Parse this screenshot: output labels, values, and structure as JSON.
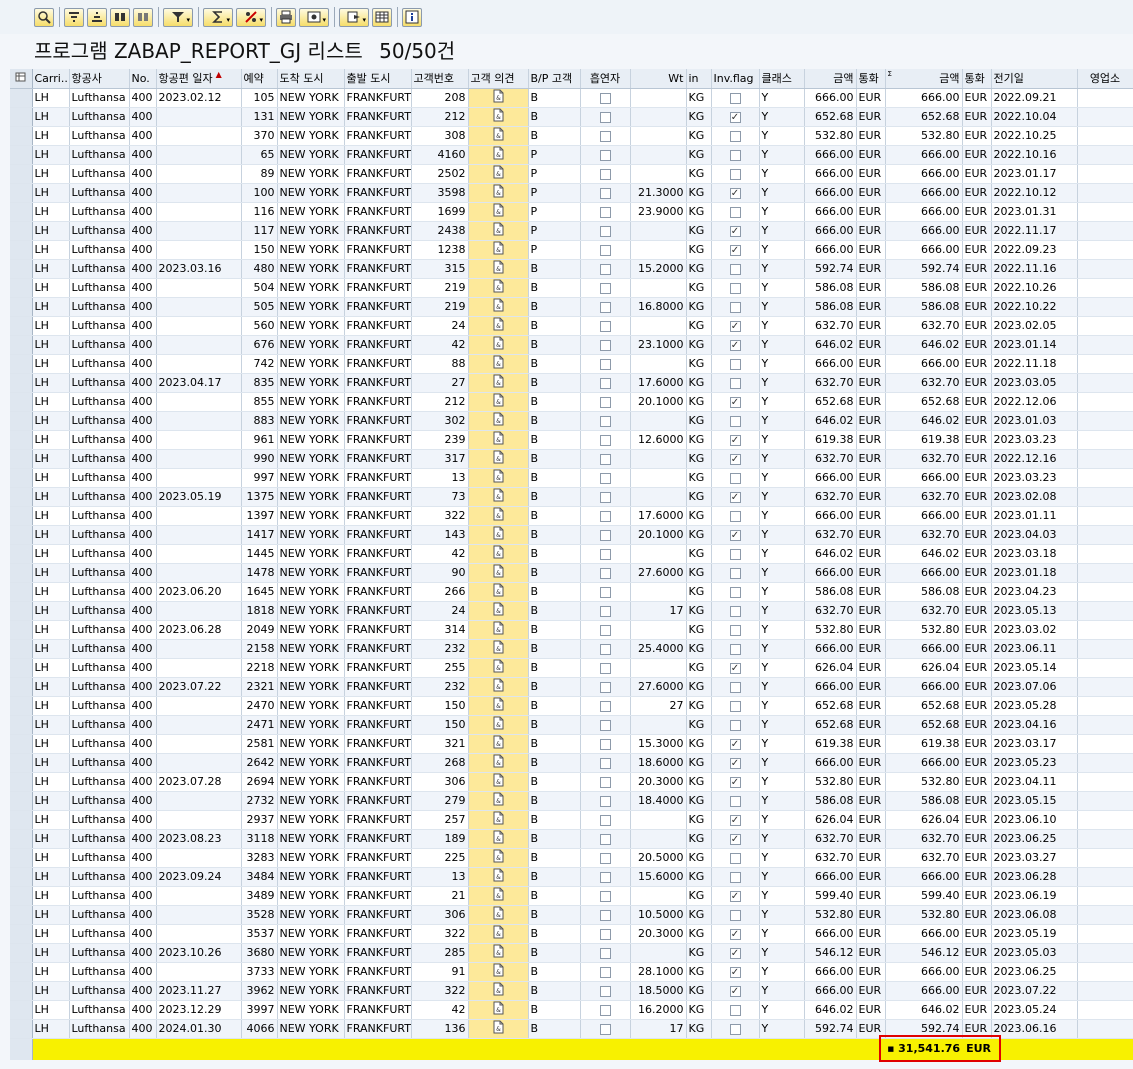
{
  "toolbar": {
    "buttons": [
      {
        "name": "details-icon"
      },
      {
        "name": "sort-ascending-icon"
      },
      {
        "name": "sort-descending-icon"
      },
      {
        "name": "find-icon"
      },
      {
        "name": "find-next-icon"
      },
      {
        "name": "filter-icon",
        "dropdown": true
      },
      {
        "name": "sum-icon",
        "dropdown": true
      },
      {
        "name": "subtotal-icon",
        "dropdown": true
      },
      {
        "name": "print-icon"
      },
      {
        "name": "view-icon",
        "dropdown": true
      },
      {
        "name": "export-icon",
        "dropdown": true
      },
      {
        "name": "layout-icon"
      },
      {
        "name": "info-icon"
      }
    ]
  },
  "title": {
    "program": "프로그램 ZABAP_REPORT_GJ 리스트",
    "count": "50/50건"
  },
  "columns": [
    "Carri...",
    "항공사",
    "No.",
    "항공편 일자",
    "예약",
    "도착 도시",
    "출발 도시",
    "고객번호",
    "고객 의견",
    "B/P 고객",
    "흡연자",
    "Wt",
    "in",
    "Inv.flag",
    "클래스",
    "금액",
    "통화",
    "금액",
    "통화",
    "전기일",
    "영업소"
  ],
  "rows": [
    [
      "LH",
      "Lufthansa",
      "400",
      "2023.02.12",
      "105",
      "NEW YORK",
      "FRANKFURT",
      "208",
      "B",
      false,
      "",
      "KG",
      false,
      "Y",
      "666.00",
      "EUR",
      "666.00",
      "EUR",
      "2022.09.21"
    ],
    [
      "LH",
      "Lufthansa",
      "400",
      "",
      "131",
      "NEW YORK",
      "FRANKFURT",
      "212",
      "B",
      false,
      "",
      "KG",
      true,
      "Y",
      "652.68",
      "EUR",
      "652.68",
      "EUR",
      "2022.10.04"
    ],
    [
      "LH",
      "Lufthansa",
      "400",
      "",
      "370",
      "NEW YORK",
      "FRANKFURT",
      "308",
      "B",
      false,
      "",
      "KG",
      false,
      "Y",
      "532.80",
      "EUR",
      "532.80",
      "EUR",
      "2022.10.25"
    ],
    [
      "LH",
      "Lufthansa",
      "400",
      "",
      "65",
      "NEW YORK",
      "FRANKFURT",
      "4160",
      "P",
      false,
      "",
      "KG",
      false,
      "Y",
      "666.00",
      "EUR",
      "666.00",
      "EUR",
      "2022.10.16"
    ],
    [
      "LH",
      "Lufthansa",
      "400",
      "",
      "89",
      "NEW YORK",
      "FRANKFURT",
      "2502",
      "P",
      false,
      "",
      "KG",
      false,
      "Y",
      "666.00",
      "EUR",
      "666.00",
      "EUR",
      "2023.01.17"
    ],
    [
      "LH",
      "Lufthansa",
      "400",
      "",
      "100",
      "NEW YORK",
      "FRANKFURT",
      "3598",
      "P",
      false,
      "21.3000",
      "KG",
      true,
      "Y",
      "666.00",
      "EUR",
      "666.00",
      "EUR",
      "2022.10.12"
    ],
    [
      "LH",
      "Lufthansa",
      "400",
      "",
      "116",
      "NEW YORK",
      "FRANKFURT",
      "1699",
      "P",
      false,
      "23.9000",
      "KG",
      false,
      "Y",
      "666.00",
      "EUR",
      "666.00",
      "EUR",
      "2023.01.31"
    ],
    [
      "LH",
      "Lufthansa",
      "400",
      "",
      "117",
      "NEW YORK",
      "FRANKFURT",
      "2438",
      "P",
      false,
      "",
      "KG",
      true,
      "Y",
      "666.00",
      "EUR",
      "666.00",
      "EUR",
      "2022.11.17"
    ],
    [
      "LH",
      "Lufthansa",
      "400",
      "",
      "150",
      "NEW YORK",
      "FRANKFURT",
      "1238",
      "P",
      false,
      "",
      "KG",
      true,
      "Y",
      "666.00",
      "EUR",
      "666.00",
      "EUR",
      "2022.09.23"
    ],
    [
      "LH",
      "Lufthansa",
      "400",
      "2023.03.16",
      "480",
      "NEW YORK",
      "FRANKFURT",
      "315",
      "B",
      false,
      "15.2000",
      "KG",
      false,
      "Y",
      "592.74",
      "EUR",
      "592.74",
      "EUR",
      "2022.11.16"
    ],
    [
      "LH",
      "Lufthansa",
      "400",
      "",
      "504",
      "NEW YORK",
      "FRANKFURT",
      "219",
      "B",
      false,
      "",
      "KG",
      false,
      "Y",
      "586.08",
      "EUR",
      "586.08",
      "EUR",
      "2022.10.26"
    ],
    [
      "LH",
      "Lufthansa",
      "400",
      "",
      "505",
      "NEW YORK",
      "FRANKFURT",
      "219",
      "B",
      false,
      "16.8000",
      "KG",
      false,
      "Y",
      "586.08",
      "EUR",
      "586.08",
      "EUR",
      "2022.10.22"
    ],
    [
      "LH",
      "Lufthansa",
      "400",
      "",
      "560",
      "NEW YORK",
      "FRANKFURT",
      "24",
      "B",
      false,
      "",
      "KG",
      true,
      "Y",
      "632.70",
      "EUR",
      "632.70",
      "EUR",
      "2023.02.05"
    ],
    [
      "LH",
      "Lufthansa",
      "400",
      "",
      "676",
      "NEW YORK",
      "FRANKFURT",
      "42",
      "B",
      false,
      "23.1000",
      "KG",
      true,
      "Y",
      "646.02",
      "EUR",
      "646.02",
      "EUR",
      "2023.01.14"
    ],
    [
      "LH",
      "Lufthansa",
      "400",
      "",
      "742",
      "NEW YORK",
      "FRANKFURT",
      "88",
      "B",
      false,
      "",
      "KG",
      false,
      "Y",
      "666.00",
      "EUR",
      "666.00",
      "EUR",
      "2022.11.18"
    ],
    [
      "LH",
      "Lufthansa",
      "400",
      "2023.04.17",
      "835",
      "NEW YORK",
      "FRANKFURT",
      "27",
      "B",
      false,
      "17.6000",
      "KG",
      false,
      "Y",
      "632.70",
      "EUR",
      "632.70",
      "EUR",
      "2023.03.05"
    ],
    [
      "LH",
      "Lufthansa",
      "400",
      "",
      "855",
      "NEW YORK",
      "FRANKFURT",
      "212",
      "B",
      false,
      "20.1000",
      "KG",
      true,
      "Y",
      "652.68",
      "EUR",
      "652.68",
      "EUR",
      "2022.12.06"
    ],
    [
      "LH",
      "Lufthansa",
      "400",
      "",
      "883",
      "NEW YORK",
      "FRANKFURT",
      "302",
      "B",
      false,
      "",
      "KG",
      false,
      "Y",
      "646.02",
      "EUR",
      "646.02",
      "EUR",
      "2023.01.03"
    ],
    [
      "LH",
      "Lufthansa",
      "400",
      "",
      "961",
      "NEW YORK",
      "FRANKFURT",
      "239",
      "B",
      false,
      "12.6000",
      "KG",
      true,
      "Y",
      "619.38",
      "EUR",
      "619.38",
      "EUR",
      "2023.03.23"
    ],
    [
      "LH",
      "Lufthansa",
      "400",
      "",
      "990",
      "NEW YORK",
      "FRANKFURT",
      "317",
      "B",
      false,
      "",
      "KG",
      true,
      "Y",
      "632.70",
      "EUR",
      "632.70",
      "EUR",
      "2022.12.16"
    ],
    [
      "LH",
      "Lufthansa",
      "400",
      "",
      "997",
      "NEW YORK",
      "FRANKFURT",
      "13",
      "B",
      false,
      "",
      "KG",
      false,
      "Y",
      "666.00",
      "EUR",
      "666.00",
      "EUR",
      "2023.03.23"
    ],
    [
      "LH",
      "Lufthansa",
      "400",
      "2023.05.19",
      "1375",
      "NEW YORK",
      "FRANKFURT",
      "73",
      "B",
      false,
      "",
      "KG",
      true,
      "Y",
      "632.70",
      "EUR",
      "632.70",
      "EUR",
      "2023.02.08"
    ],
    [
      "LH",
      "Lufthansa",
      "400",
      "",
      "1397",
      "NEW YORK",
      "FRANKFURT",
      "322",
      "B",
      false,
      "17.6000",
      "KG",
      false,
      "Y",
      "666.00",
      "EUR",
      "666.00",
      "EUR",
      "2023.01.11"
    ],
    [
      "LH",
      "Lufthansa",
      "400",
      "",
      "1417",
      "NEW YORK",
      "FRANKFURT",
      "143",
      "B",
      false,
      "20.1000",
      "KG",
      true,
      "Y",
      "632.70",
      "EUR",
      "632.70",
      "EUR",
      "2023.04.03"
    ],
    [
      "LH",
      "Lufthansa",
      "400",
      "",
      "1445",
      "NEW YORK",
      "FRANKFURT",
      "42",
      "B",
      false,
      "",
      "KG",
      false,
      "Y",
      "646.02",
      "EUR",
      "646.02",
      "EUR",
      "2023.03.18"
    ],
    [
      "LH",
      "Lufthansa",
      "400",
      "",
      "1478",
      "NEW YORK",
      "FRANKFURT",
      "90",
      "B",
      false,
      "27.6000",
      "KG",
      false,
      "Y",
      "666.00",
      "EUR",
      "666.00",
      "EUR",
      "2023.01.18"
    ],
    [
      "LH",
      "Lufthansa",
      "400",
      "2023.06.20",
      "1645",
      "NEW YORK",
      "FRANKFURT",
      "266",
      "B",
      false,
      "",
      "KG",
      false,
      "Y",
      "586.08",
      "EUR",
      "586.08",
      "EUR",
      "2023.04.23"
    ],
    [
      "LH",
      "Lufthansa",
      "400",
      "",
      "1818",
      "NEW YORK",
      "FRANKFURT",
      "24",
      "B",
      false,
      "17",
      "KG",
      false,
      "Y",
      "632.70",
      "EUR",
      "632.70",
      "EUR",
      "2023.05.13"
    ],
    [
      "LH",
      "Lufthansa",
      "400",
      "2023.06.28",
      "2049",
      "NEW YORK",
      "FRANKFURT",
      "314",
      "B",
      false,
      "",
      "KG",
      false,
      "Y",
      "532.80",
      "EUR",
      "532.80",
      "EUR",
      "2023.03.02"
    ],
    [
      "LH",
      "Lufthansa",
      "400",
      "",
      "2158",
      "NEW YORK",
      "FRANKFURT",
      "232",
      "B",
      false,
      "25.4000",
      "KG",
      false,
      "Y",
      "666.00",
      "EUR",
      "666.00",
      "EUR",
      "2023.06.11"
    ],
    [
      "LH",
      "Lufthansa",
      "400",
      "",
      "2218",
      "NEW YORK",
      "FRANKFURT",
      "255",
      "B",
      false,
      "",
      "KG",
      true,
      "Y",
      "626.04",
      "EUR",
      "626.04",
      "EUR",
      "2023.05.14"
    ],
    [
      "LH",
      "Lufthansa",
      "400",
      "2023.07.22",
      "2321",
      "NEW YORK",
      "FRANKFURT",
      "232",
      "B",
      false,
      "27.6000",
      "KG",
      false,
      "Y",
      "666.00",
      "EUR",
      "666.00",
      "EUR",
      "2023.07.06"
    ],
    [
      "LH",
      "Lufthansa",
      "400",
      "",
      "2470",
      "NEW YORK",
      "FRANKFURT",
      "150",
      "B",
      false,
      "27",
      "KG",
      false,
      "Y",
      "652.68",
      "EUR",
      "652.68",
      "EUR",
      "2023.05.28"
    ],
    [
      "LH",
      "Lufthansa",
      "400",
      "",
      "2471",
      "NEW YORK",
      "FRANKFURT",
      "150",
      "B",
      false,
      "",
      "KG",
      false,
      "Y",
      "652.68",
      "EUR",
      "652.68",
      "EUR",
      "2023.04.16"
    ],
    [
      "LH",
      "Lufthansa",
      "400",
      "",
      "2581",
      "NEW YORK",
      "FRANKFURT",
      "321",
      "B",
      false,
      "15.3000",
      "KG",
      true,
      "Y",
      "619.38",
      "EUR",
      "619.38",
      "EUR",
      "2023.03.17"
    ],
    [
      "LH",
      "Lufthansa",
      "400",
      "",
      "2642",
      "NEW YORK",
      "FRANKFURT",
      "268",
      "B",
      false,
      "18.6000",
      "KG",
      true,
      "Y",
      "666.00",
      "EUR",
      "666.00",
      "EUR",
      "2023.05.23"
    ],
    [
      "LH",
      "Lufthansa",
      "400",
      "2023.07.28",
      "2694",
      "NEW YORK",
      "FRANKFURT",
      "306",
      "B",
      false,
      "20.3000",
      "KG",
      true,
      "Y",
      "532.80",
      "EUR",
      "532.80",
      "EUR",
      "2023.04.11"
    ],
    [
      "LH",
      "Lufthansa",
      "400",
      "",
      "2732",
      "NEW YORK",
      "FRANKFURT",
      "279",
      "B",
      false,
      "18.4000",
      "KG",
      false,
      "Y",
      "586.08",
      "EUR",
      "586.08",
      "EUR",
      "2023.05.15"
    ],
    [
      "LH",
      "Lufthansa",
      "400",
      "",
      "2937",
      "NEW YORK",
      "FRANKFURT",
      "257",
      "B",
      false,
      "",
      "KG",
      true,
      "Y",
      "626.04",
      "EUR",
      "626.04",
      "EUR",
      "2023.06.10"
    ],
    [
      "LH",
      "Lufthansa",
      "400",
      "2023.08.23",
      "3118",
      "NEW YORK",
      "FRANKFURT",
      "189",
      "B",
      false,
      "",
      "KG",
      true,
      "Y",
      "632.70",
      "EUR",
      "632.70",
      "EUR",
      "2023.06.25"
    ],
    [
      "LH",
      "Lufthansa",
      "400",
      "",
      "3283",
      "NEW YORK",
      "FRANKFURT",
      "225",
      "B",
      false,
      "20.5000",
      "KG",
      false,
      "Y",
      "632.70",
      "EUR",
      "632.70",
      "EUR",
      "2023.03.27"
    ],
    [
      "LH",
      "Lufthansa",
      "400",
      "2023.09.24",
      "3484",
      "NEW YORK",
      "FRANKFURT",
      "13",
      "B",
      false,
      "15.6000",
      "KG",
      false,
      "Y",
      "666.00",
      "EUR",
      "666.00",
      "EUR",
      "2023.06.28"
    ],
    [
      "LH",
      "Lufthansa",
      "400",
      "",
      "3489",
      "NEW YORK",
      "FRANKFURT",
      "21",
      "B",
      false,
      "",
      "KG",
      true,
      "Y",
      "599.40",
      "EUR",
      "599.40",
      "EUR",
      "2023.06.19"
    ],
    [
      "LH",
      "Lufthansa",
      "400",
      "",
      "3528",
      "NEW YORK",
      "FRANKFURT",
      "306",
      "B",
      false,
      "10.5000",
      "KG",
      false,
      "Y",
      "532.80",
      "EUR",
      "532.80",
      "EUR",
      "2023.06.08"
    ],
    [
      "LH",
      "Lufthansa",
      "400",
      "",
      "3537",
      "NEW YORK",
      "FRANKFURT",
      "322",
      "B",
      false,
      "20.3000",
      "KG",
      true,
      "Y",
      "666.00",
      "EUR",
      "666.00",
      "EUR",
      "2023.05.19"
    ],
    [
      "LH",
      "Lufthansa",
      "400",
      "2023.10.26",
      "3680",
      "NEW YORK",
      "FRANKFURT",
      "285",
      "B",
      false,
      "",
      "KG",
      true,
      "Y",
      "546.12",
      "EUR",
      "546.12",
      "EUR",
      "2023.05.03"
    ],
    [
      "LH",
      "Lufthansa",
      "400",
      "",
      "3733",
      "NEW YORK",
      "FRANKFURT",
      "91",
      "B",
      false,
      "28.1000",
      "KG",
      true,
      "Y",
      "666.00",
      "EUR",
      "666.00",
      "EUR",
      "2023.06.25"
    ],
    [
      "LH",
      "Lufthansa",
      "400",
      "2023.11.27",
      "3962",
      "NEW YORK",
      "FRANKFURT",
      "322",
      "B",
      false,
      "18.5000",
      "KG",
      true,
      "Y",
      "666.00",
      "EUR",
      "666.00",
      "EUR",
      "2023.07.22"
    ],
    [
      "LH",
      "Lufthansa",
      "400",
      "2023.12.29",
      "3997",
      "NEW YORK",
      "FRANKFURT",
      "42",
      "B",
      false,
      "16.2000",
      "KG",
      false,
      "Y",
      "646.02",
      "EUR",
      "646.02",
      "EUR",
      "2023.05.24"
    ],
    [
      "LH",
      "Lufthansa",
      "400",
      "2024.01.30",
      "4066",
      "NEW YORK",
      "FRANKFURT",
      "136",
      "B",
      false,
      "17",
      "KG",
      false,
      "Y",
      "592.74",
      "EUR",
      "592.74",
      "EUR",
      "2023.06.16"
    ]
  ],
  "total": {
    "marker": "■",
    "amount": "31,541.76",
    "currency": "EUR"
  },
  "colors": {
    "highlight_row": "#f8f100",
    "total_border": "#e00000",
    "note_cell": "#fde99a"
  }
}
